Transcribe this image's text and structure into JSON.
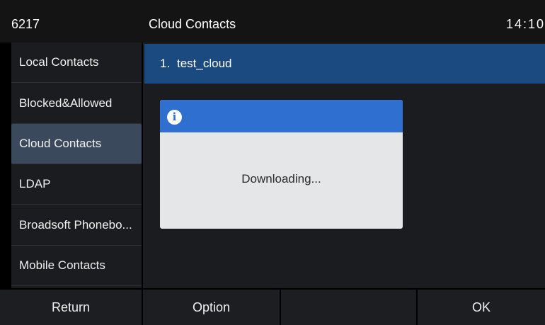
{
  "status_bar": {
    "extension": "6217",
    "title": "Cloud Contacts",
    "time": "14:10"
  },
  "sidebar": {
    "items": [
      {
        "label": "Local Contacts",
        "selected": false
      },
      {
        "label": "Blocked&Allowed",
        "selected": false
      },
      {
        "label": "Cloud Contacts",
        "selected": true
      },
      {
        "label": "LDAP",
        "selected": false
      },
      {
        "label": "Broadsoft Phonebo...",
        "selected": false
      },
      {
        "label": "Mobile Contacts",
        "selected": false
      }
    ]
  },
  "contacts": {
    "rows": [
      {
        "index": "1.",
        "name": "test_cloud"
      }
    ]
  },
  "dialog": {
    "icon": "info-icon",
    "message": "Downloading..."
  },
  "softkeys": [
    "Return",
    "Option",
    "",
    "OK"
  ],
  "colors": {
    "selected_row": "#1b4a80",
    "sidebar_selected": "#3a4a5c",
    "dialog_header": "#2f6fd0",
    "dialog_body": "#e4e6e8"
  }
}
